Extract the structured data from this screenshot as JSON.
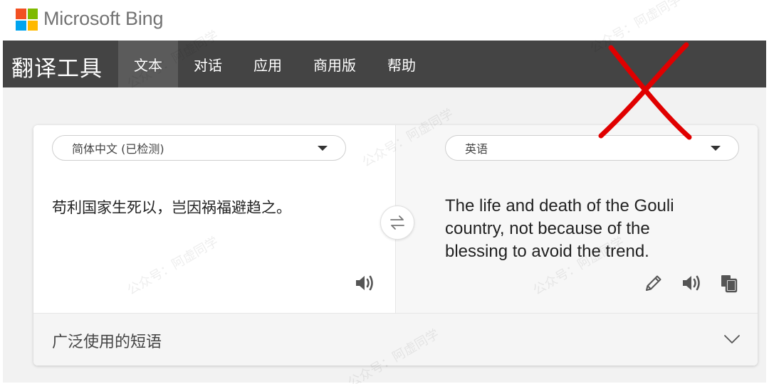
{
  "brand": {
    "name": "Microsoft Bing"
  },
  "nav": {
    "title": "翻译工具",
    "tabs": [
      {
        "label": "文本",
        "active": true
      },
      {
        "label": "对话",
        "active": false
      },
      {
        "label": "应用",
        "active": false
      },
      {
        "label": "商用版",
        "active": false
      },
      {
        "label": "帮助",
        "active": false
      }
    ]
  },
  "source": {
    "language": "简体中文 (已检测)",
    "text": "苟利国家生死以，岂因祸福避趋之。"
  },
  "target": {
    "language": "英语",
    "text": "The life and death of the Gouli country, not because of the blessing to avoid the trend."
  },
  "phrases": {
    "label": "广泛使用的短语"
  },
  "watermark": {
    "text": "公众号：阿虚同学"
  },
  "colors": {
    "nav_bg": "#444444",
    "nav_active": "#5b5b5b",
    "annotation_red": "#e00000"
  },
  "icons": [
    "speaker-icon",
    "swap-icon",
    "pencil-icon",
    "copy-icon",
    "chevron-down-icon"
  ]
}
